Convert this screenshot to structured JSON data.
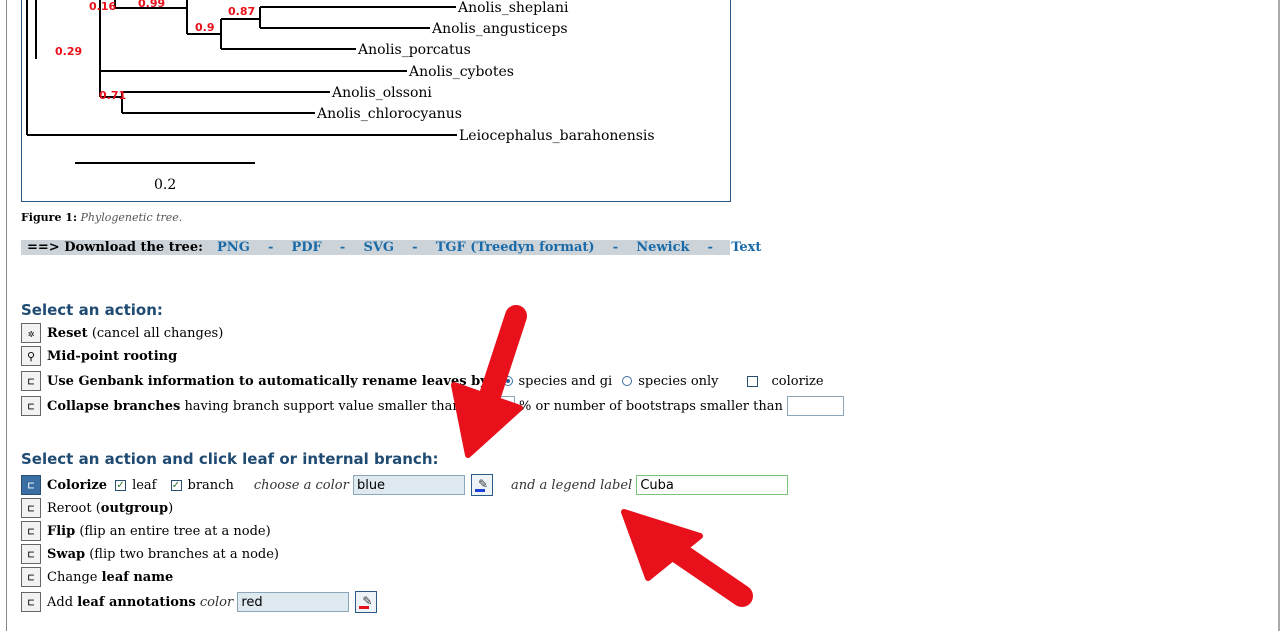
{
  "tree": {
    "leaves": [
      "Anolis_sheplani",
      "Anolis_angusticeps",
      "Anolis_porcatus",
      "Anolis_cybotes",
      "Anolis_olssoni",
      "Anolis_chlorocyanus",
      "Leiocephalus_barahonensis"
    ],
    "supports": [
      "0.16",
      "0.99",
      "0.87",
      "0.9",
      "0.29",
      "0.71"
    ],
    "scale_label": "0.2"
  },
  "caption": {
    "label": "Figure 1:",
    "text": "Phylogenetic tree."
  },
  "download": {
    "lead": "==> Download the tree:",
    "links": [
      "PNG",
      "PDF",
      "SVG",
      "TGF (Treedyn format)",
      "Newick",
      "Text"
    ],
    "separator": "-"
  },
  "section1": {
    "title": "Select an action:",
    "reset": {
      "bold": "Reset",
      "rest": "(cancel all changes)"
    },
    "midpoint": {
      "bold": "Mid-point rooting"
    },
    "genbank": {
      "bold": "Use Genbank information to automatically rename leaves by:",
      "option1": "species and gi",
      "option2": "species only",
      "option3": "colorize"
    },
    "collapse": {
      "bold": "Collapse branches",
      "rest": "having branch support value smaller than",
      "value": "50",
      "unit": "%",
      "rest2": "or number of bootstraps smaller than",
      "value2": ""
    }
  },
  "section2": {
    "title": "Select an action and click leaf or internal branch:",
    "colorize": {
      "bold": "Colorize",
      "leaf": "leaf",
      "branch": "branch",
      "choose": "choose a color",
      "color_value": "blue",
      "legend_label": "and a legend label",
      "legend_value": "Cuba"
    },
    "reroot": {
      "plain": "Reroot",
      "bold": "outgroup"
    },
    "flip": {
      "bold": "Flip",
      "rest": "(flip an entire tree at a node)"
    },
    "swap": {
      "bold": "Swap",
      "rest": "(flip two branches at a node)"
    },
    "change": {
      "plain": "Change",
      "bold": "leaf name"
    },
    "annot": {
      "plain": "Add",
      "bold": "leaf annotations",
      "color_label": "color",
      "color_value": "red"
    }
  },
  "colors": {
    "support": "#e8101a",
    "arrow": "#e8101a",
    "section_title": "#1f4a72",
    "link": "#1a6aa8"
  }
}
